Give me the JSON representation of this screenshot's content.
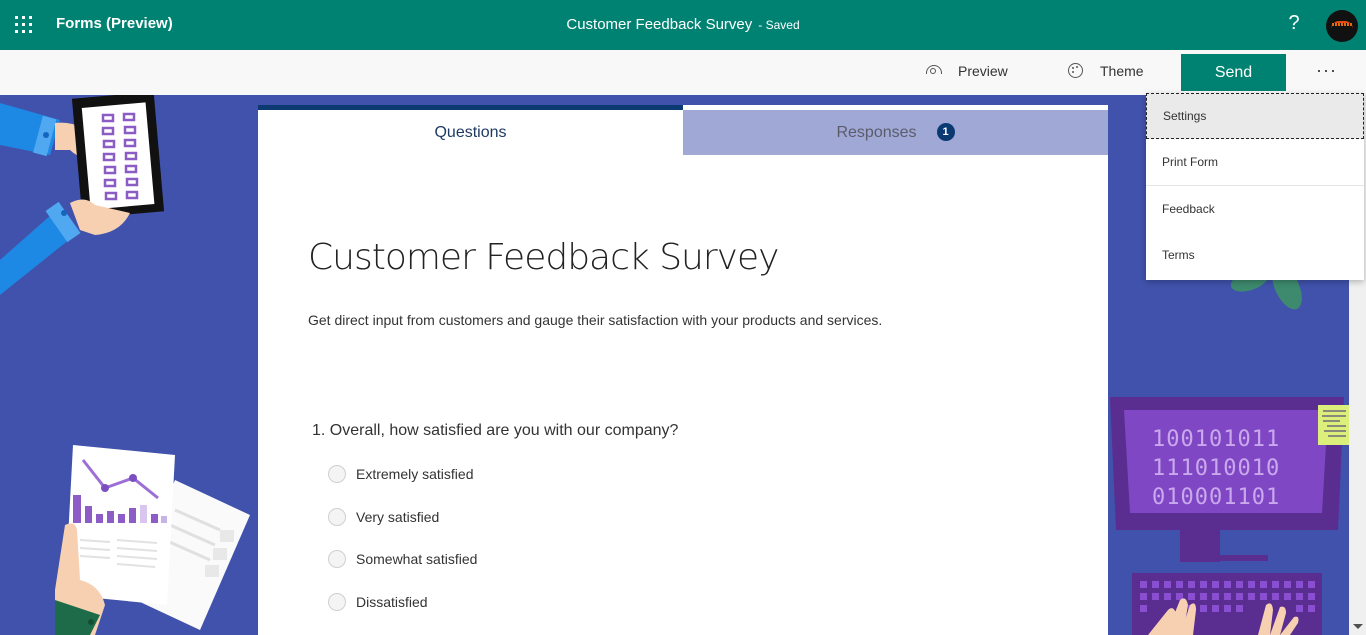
{
  "appbar": {
    "app_name": "Forms (Preview)",
    "doc_title": "Customer Feedback Survey",
    "doc_status": "- Saved",
    "help_label": "?",
    "icons": {
      "launcher": "waffle-icon",
      "help": "help-icon",
      "avatar": "user-avatar"
    }
  },
  "commandbar": {
    "preview_label": "Preview",
    "theme_label": "Theme",
    "send_label": "Send",
    "more_label": "···"
  },
  "tabs": [
    {
      "label": "Questions",
      "active": true
    },
    {
      "label": "Responses",
      "active": false,
      "badge": "1"
    }
  ],
  "form": {
    "title": "Customer Feedback Survey",
    "description": "Get direct input from customers and gauge their satisfaction with your products and services.",
    "questions": [
      {
        "number": "1.",
        "text": "Overall, how satisfied are you with our company?",
        "options": [
          "Extremely satisfied",
          "Very satisfied",
          "Somewhat satisfied",
          "Dissatisfied"
        ]
      }
    ]
  },
  "menu": {
    "items": [
      "Settings",
      "Print Form",
      "Feedback",
      "Terms"
    ],
    "focused": "Settings"
  },
  "illustration": {
    "binary_lines": [
      "100101011",
      "111010010",
      "010001101"
    ]
  },
  "colors": {
    "brand": "#008272",
    "background": "#4052ab",
    "tab_accent": "#0b3a72",
    "inactive_tab": "#a0a9d6"
  }
}
